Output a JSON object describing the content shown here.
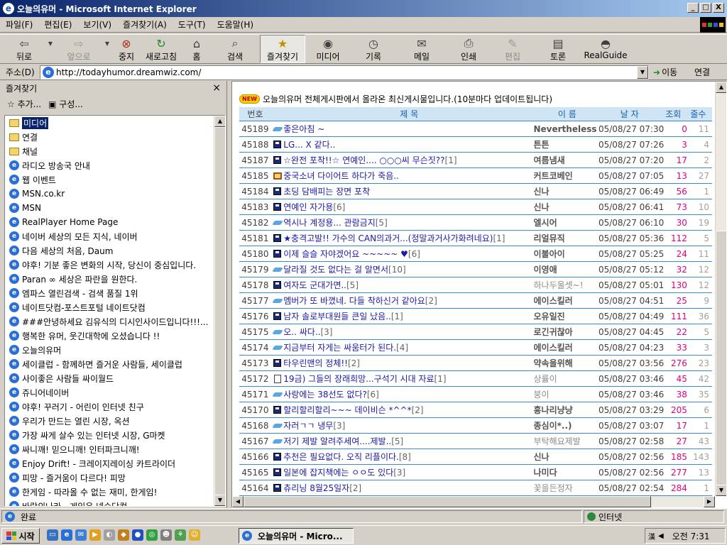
{
  "window": {
    "title": "오늘의유머 - Microsoft Internet Explorer",
    "min": "_",
    "max": "□",
    "close": "X"
  },
  "menu": [
    "파일(F)",
    "편집(E)",
    "보기(V)",
    "즐겨찾기(A)",
    "도구(T)",
    "도움말(H)"
  ],
  "toolbar": {
    "back": "뒤로",
    "forward": "앞으로",
    "stop": "중지",
    "refresh": "새로고침",
    "home": "홈",
    "search": "검색",
    "favorites": "즐겨찾기",
    "media": "미디어",
    "history": "기록",
    "mail": "메일",
    "print": "인쇄",
    "edit": "편집",
    "discuss": "토론",
    "realguide": "RealGuide"
  },
  "address": {
    "label": "주소(D)",
    "url": "http://todayhumor.dreamwiz.com/",
    "go": "이동",
    "links": "연결"
  },
  "favorites": {
    "title": "즐겨찾기",
    "close": "×",
    "add": "추가...",
    "organize": "구성...",
    "items": [
      {
        "label": "미디어",
        "type": "folder"
      },
      {
        "label": "연결",
        "type": "folder"
      },
      {
        "label": "채널",
        "type": "folder"
      },
      {
        "label": "라디오 방송국 안내",
        "type": "link"
      },
      {
        "label": "웹 이벤트",
        "type": "link"
      },
      {
        "label": "MSN.co.kr",
        "type": "link"
      },
      {
        "label": "MSN",
        "type": "link"
      },
      {
        "label": "RealPlayer Home Page",
        "type": "link"
      },
      {
        "label": "네이버 세상의 모든 지식, 네이버",
        "type": "link"
      },
      {
        "label": "다음 세상의 처음, Daum",
        "type": "link"
      },
      {
        "label": "야후! 기분 좋은 변화의 시작, 당신이 중심입니다.",
        "type": "link"
      },
      {
        "label": "Paran ∞ 세상은 파란을 원한다.",
        "type": "link"
      },
      {
        "label": "엠파스 열린검색 - 검색 품질 1위",
        "type": "link"
      },
      {
        "label": "네이트닷컴-포스트포털 네이트닷컴",
        "type": "link"
      },
      {
        "label": "###안녕하세요 김유식의 디시인사이드입니다!!!...",
        "type": "link"
      },
      {
        "label": "행복한 유머, 웃긴대학에 오셨습니다 !!",
        "type": "link"
      },
      {
        "label": "오늘의유머",
        "type": "link"
      },
      {
        "label": "세이클럽 - 함께하면 즐거운 사람들, 세이클럽",
        "type": "link"
      },
      {
        "label": "사이좋은 사람들 싸이월드",
        "type": "link"
      },
      {
        "label": "쥬니어네이버",
        "type": "link"
      },
      {
        "label": "야후! 꾸러기 - 어린이 인터넷 친구",
        "type": "link"
      },
      {
        "label": "우리가 만드는 열린 시장, 옥션",
        "type": "link"
      },
      {
        "label": "가장 싸게 살수 있는 인터넷 시장, G마켓",
        "type": "link"
      },
      {
        "label": "싸니깨! 믿으니깨! 인터파크니깨!",
        "type": "link"
      },
      {
        "label": "Enjoy Drift! - 크레이지레이싱 카트라이더",
        "type": "link"
      },
      {
        "label": "피망 - 즐거움이 다르다! 피망",
        "type": "link"
      },
      {
        "label": "한게임 - 따라올 수 없는 재미, 한게임!",
        "type": "link"
      },
      {
        "label": "바람의나라 - 게임은 넥슨닷컴",
        "type": "link"
      }
    ]
  },
  "board": {
    "notice": "오늘의유머 전체게시판에서 올라온 최신게시물입니다.(10분마다 업데이트됩니다)",
    "new_badge": "NEW",
    "headers": {
      "no": "번호",
      "subject": "제 목",
      "author": "이 름",
      "date": "날 자",
      "hits": "조회",
      "rec": "줄수"
    },
    "rows": [
      {
        "no": "45189",
        "icon": "bird",
        "subject": "좋은아침 ~",
        "comments": "",
        "author": "Nevertheless",
        "author_gray": false,
        "date": "05/08/27 07:30",
        "hits": "0",
        "rec": "11"
      },
      {
        "no": "45188",
        "icon": "disk",
        "subject": "LG... X 같다..",
        "comments": "",
        "author": "튼튼",
        "author_gray": false,
        "date": "05/08/27 07:26",
        "hits": "3",
        "rec": "4"
      },
      {
        "no": "45187",
        "icon": "disk",
        "subject": "☆완전 포착!!☆ 연예인.... ○○○씨 무슨짓??",
        "comments": "[1]",
        "author": "여름냄새",
        "author_gray": false,
        "date": "05/08/27 07:20",
        "hits": "17",
        "rec": "2"
      },
      {
        "no": "45185",
        "icon": "tv",
        "subject": "중국소녀 다이어트 하다가 죽음..",
        "comments": "",
        "author": "커트코베인",
        "author_gray": false,
        "date": "05/08/27 07:05",
        "hits": "13",
        "rec": "27"
      },
      {
        "no": "45184",
        "icon": "disk",
        "subject": "초딩 담배피는 장면 포착",
        "comments": "",
        "author": "신나",
        "author_gray": false,
        "date": "05/08/27 06:49",
        "hits": "56",
        "rec": "1"
      },
      {
        "no": "45183",
        "icon": "disk",
        "subject": "연예인 자가용",
        "comments": "[6]",
        "author": "신나",
        "author_gray": false,
        "date": "05/08/27 06:41",
        "hits": "73",
        "rec": "10"
      },
      {
        "no": "45182",
        "icon": "bird",
        "subject": "역시나 계정용... 관람금지",
        "comments": "[5]",
        "author": "엘시어",
        "author_gray": false,
        "date": "05/08/27 06:10",
        "hits": "30",
        "rec": "19"
      },
      {
        "no": "45181",
        "icon": "disk",
        "subject": "★충격고발!! 가수의 CAN의과거...(정말과거사가화려네요)",
        "comments": "[1]",
        "author": "리얼뮤직",
        "author_gray": false,
        "date": "05/08/27 05:36",
        "hits": "112",
        "rec": "5"
      },
      {
        "no": "45180",
        "icon": "disk",
        "subject": "이제 슬슬 자야겠어요 ~~~~~ ♥",
        "comments": "[6]",
        "author": "이불아이",
        "author_gray": false,
        "date": "05/08/27 05:25",
        "hits": "24",
        "rec": "11"
      },
      {
        "no": "45179",
        "icon": "bird",
        "subject": "달라질 것도 없다는 걸 알면서",
        "comments": "[10]",
        "author": "이영애",
        "author_gray": false,
        "date": "05/08/27 05:12",
        "hits": "32",
        "rec": "12"
      },
      {
        "no": "45178",
        "icon": "disk",
        "subject": "여자도 군대가면..",
        "comments": "[5]",
        "author": "하나두울셋~!",
        "author_gray": true,
        "date": "05/08/27 05:01",
        "hits": "130",
        "rec": "12"
      },
      {
        "no": "45177",
        "icon": "bird",
        "subject": "멤버가 또 바꼈네. 다들 착하신거 같아요",
        "comments": "[2]",
        "author": "에이스킬러",
        "author_gray": false,
        "date": "05/08/27 04:51",
        "hits": "25",
        "rec": "9"
      },
      {
        "no": "45176",
        "icon": "disk",
        "subject": "남자 솔로부대원들 큰일 났음..",
        "comments": "[1]",
        "author": "오유일진",
        "author_gray": false,
        "date": "05/08/27 04:49",
        "hits": "111",
        "rec": "36"
      },
      {
        "no": "45175",
        "icon": "bird",
        "subject": "오.. 싸다..",
        "comments": "[3]",
        "author": "로긴귀찮아",
        "author_gray": false,
        "date": "05/08/27 04:45",
        "hits": "22",
        "rec": "5"
      },
      {
        "no": "45174",
        "icon": "bird",
        "subject": "지금부터 자게는 싸움터가 된다.",
        "comments": "[4]",
        "author": "에이스킬러",
        "author_gray": false,
        "date": "05/08/27 04:23",
        "hits": "33",
        "rec": "3"
      },
      {
        "no": "45173",
        "icon": "disk",
        "subject": "타우린맨의 정체!!",
        "comments": "[2]",
        "author": "약속을위해",
        "author_gray": false,
        "date": "05/08/27 03:56",
        "hits": "276",
        "rec": "23"
      },
      {
        "no": "45172",
        "icon": "doc",
        "subject": "19금) 그들의 장래희망...구석기 시대 자료",
        "comments": "[1]",
        "author": "상률이",
        "author_gray": true,
        "date": "05/08/27 03:46",
        "hits": "45",
        "rec": "42"
      },
      {
        "no": "45171",
        "icon": "bird",
        "subject": "사랑에는 38선도 없다?",
        "comments": "[6]",
        "author": "붕이",
        "author_gray": true,
        "date": "05/08/27 03:46",
        "hits": "38",
        "rec": "35"
      },
      {
        "no": "45170",
        "icon": "disk",
        "subject": "할리할리할리~~~ 데이비슨 *^^*",
        "comments": "[2]",
        "author": "흥나리냥냥",
        "author_gray": false,
        "date": "05/08/27 03:29",
        "hits": "205",
        "rec": "6"
      },
      {
        "no": "45168",
        "icon": "bird",
        "subject": "자러ㄱㄱ 냉무",
        "comments": "[3]",
        "author": "종심이*..)",
        "author_gray": false,
        "date": "05/08/27 03:07",
        "hits": "17",
        "rec": "1"
      },
      {
        "no": "45167",
        "icon": "bird",
        "subject": "저기 제발 알려주세여....제발..",
        "comments": "[5]",
        "author": "부탁해요제발",
        "author_gray": true,
        "date": "05/08/27 02:58",
        "hits": "27",
        "rec": "43"
      },
      {
        "no": "45166",
        "icon": "disk",
        "subject": "추천은 필요없다. 오직 리플이다.",
        "comments": "[8]",
        "author": "신나",
        "author_gray": false,
        "date": "05/08/27 02:56",
        "hits": "185",
        "rec": "143"
      },
      {
        "no": "45165",
        "icon": "disk",
        "subject": "일본에 잡지책에는 ㅇㅇ도 있다",
        "comments": "[3]",
        "author": "나미다",
        "author_gray": false,
        "date": "05/08/27 02:56",
        "hits": "277",
        "rec": "13"
      },
      {
        "no": "45164",
        "icon": "disk",
        "subject": "츄리닝 8월25일자",
        "comments": "[2]",
        "author": "꽃을든정자",
        "author_gray": true,
        "date": "05/08/27 02:54",
        "hits": "284",
        "rec": "1"
      }
    ]
  },
  "status": {
    "text": "완료",
    "zone": "인터넷"
  },
  "taskbar": {
    "start": "시작",
    "task": "오늘의유머 - Micro...",
    "time": "오전 7:31"
  }
}
